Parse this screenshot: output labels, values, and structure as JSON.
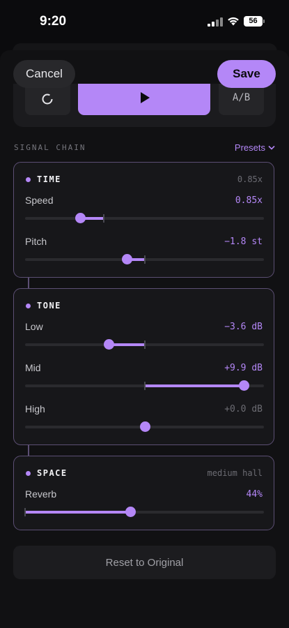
{
  "status_bar": {
    "time": "9:20",
    "battery": "56"
  },
  "header": {
    "cancel_label": "Cancel",
    "save_label": "Save"
  },
  "transport": {
    "left_icon": "loop-icon",
    "play_icon": "play-icon",
    "ab_label": "A/B"
  },
  "chain": {
    "label": "SIGNAL CHAIN",
    "presets_label": "Presets"
  },
  "modules": {
    "time": {
      "title": "TIME",
      "meta": "0.85x",
      "params": [
        {
          "label": "Speed",
          "value": "0.85x",
          "level": 0.23,
          "center": 0.33
        },
        {
          "label": "Pitch",
          "value": "−1.8 st",
          "level": 0.425,
          "center": 0.5
        }
      ]
    },
    "tone": {
      "title": "TONE",
      "params": [
        {
          "label": "Low",
          "value": "−3.6 dB",
          "level": 0.35,
          "center": 0.5
        },
        {
          "label": "Mid",
          "value": "+9.9 dB",
          "level": 0.915,
          "center": 0.5
        },
        {
          "label": "High",
          "value": "+0.0 dB",
          "level": 0.5,
          "center": 0.5
        }
      ]
    },
    "space": {
      "title": "SPACE",
      "meta": "medium hall",
      "params": [
        {
          "label": "Reverb",
          "value": "44%",
          "level": 0.44,
          "center": 0
        }
      ]
    }
  },
  "reset_label": "Reset to Original",
  "colors": {
    "accent": "#b487f7",
    "background": "#0b0b0d",
    "card_border": "#5c4f74"
  }
}
